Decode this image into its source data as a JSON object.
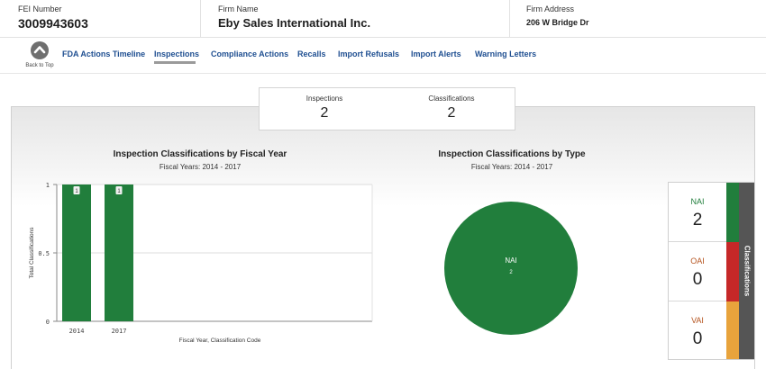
{
  "header": {
    "fei_label": "FEI Number",
    "fei_value": "3009943603",
    "firm_label": "Firm Name",
    "firm_value": "Eby Sales International Inc.",
    "address_label": "Firm Address",
    "address_value": "206 W Bridge Dr"
  },
  "nav": {
    "back_to_top": "Back to Top",
    "tabs": [
      {
        "label": "FDA Actions Timeline"
      },
      {
        "label": "Inspections",
        "active": true
      },
      {
        "label": "Compliance Actions"
      },
      {
        "label": "Recalls"
      },
      {
        "label": "Import Refusals"
      },
      {
        "label": "Import Alerts"
      },
      {
        "label": "Warning Letters"
      }
    ]
  },
  "summary": {
    "inspections_label": "Inspections",
    "inspections_value": "2",
    "classifications_label": "Classifications",
    "classifications_value": "2"
  },
  "bar_chart": {
    "title": "Inspection Classifications by Fiscal Year",
    "subtitle": "Fiscal Years: 2014 - 2017"
  },
  "pie_chart": {
    "title": "Inspection Classifications by Type",
    "subtitle": "Fiscal Years: 2014 - 2017"
  },
  "classifications": {
    "vertical_label": "Classifications",
    "items": [
      {
        "label": "NAI",
        "value": "2",
        "color": "#217e3c"
      },
      {
        "label": "OAI",
        "value": "0",
        "color": "#c62828"
      },
      {
        "label": "VAI",
        "value": "0",
        "color": "#e8a33c"
      }
    ]
  },
  "colors": {
    "nai_green": "#217e3c",
    "oai_red": "#c62828",
    "vai_orange": "#e8a33c",
    "tab_blue": "#1f4f91"
  },
  "chart_data": [
    {
      "type": "bar",
      "categories": [
        "2014",
        "2017"
      ],
      "series": [
        {
          "name": "NAI",
          "values": [
            1,
            1
          ]
        }
      ],
      "data_labels": [
        "1",
        "1"
      ],
      "ylim": [
        0,
        1
      ],
      "yticks": [
        "0",
        "0.5",
        "1"
      ],
      "xlabel": "Fiscal Year, Classification Code",
      "ylabel": "Total Classifications",
      "grid": true
    },
    {
      "type": "pie",
      "slices": [
        {
          "label": "NAI",
          "value": 2
        }
      ]
    }
  ]
}
